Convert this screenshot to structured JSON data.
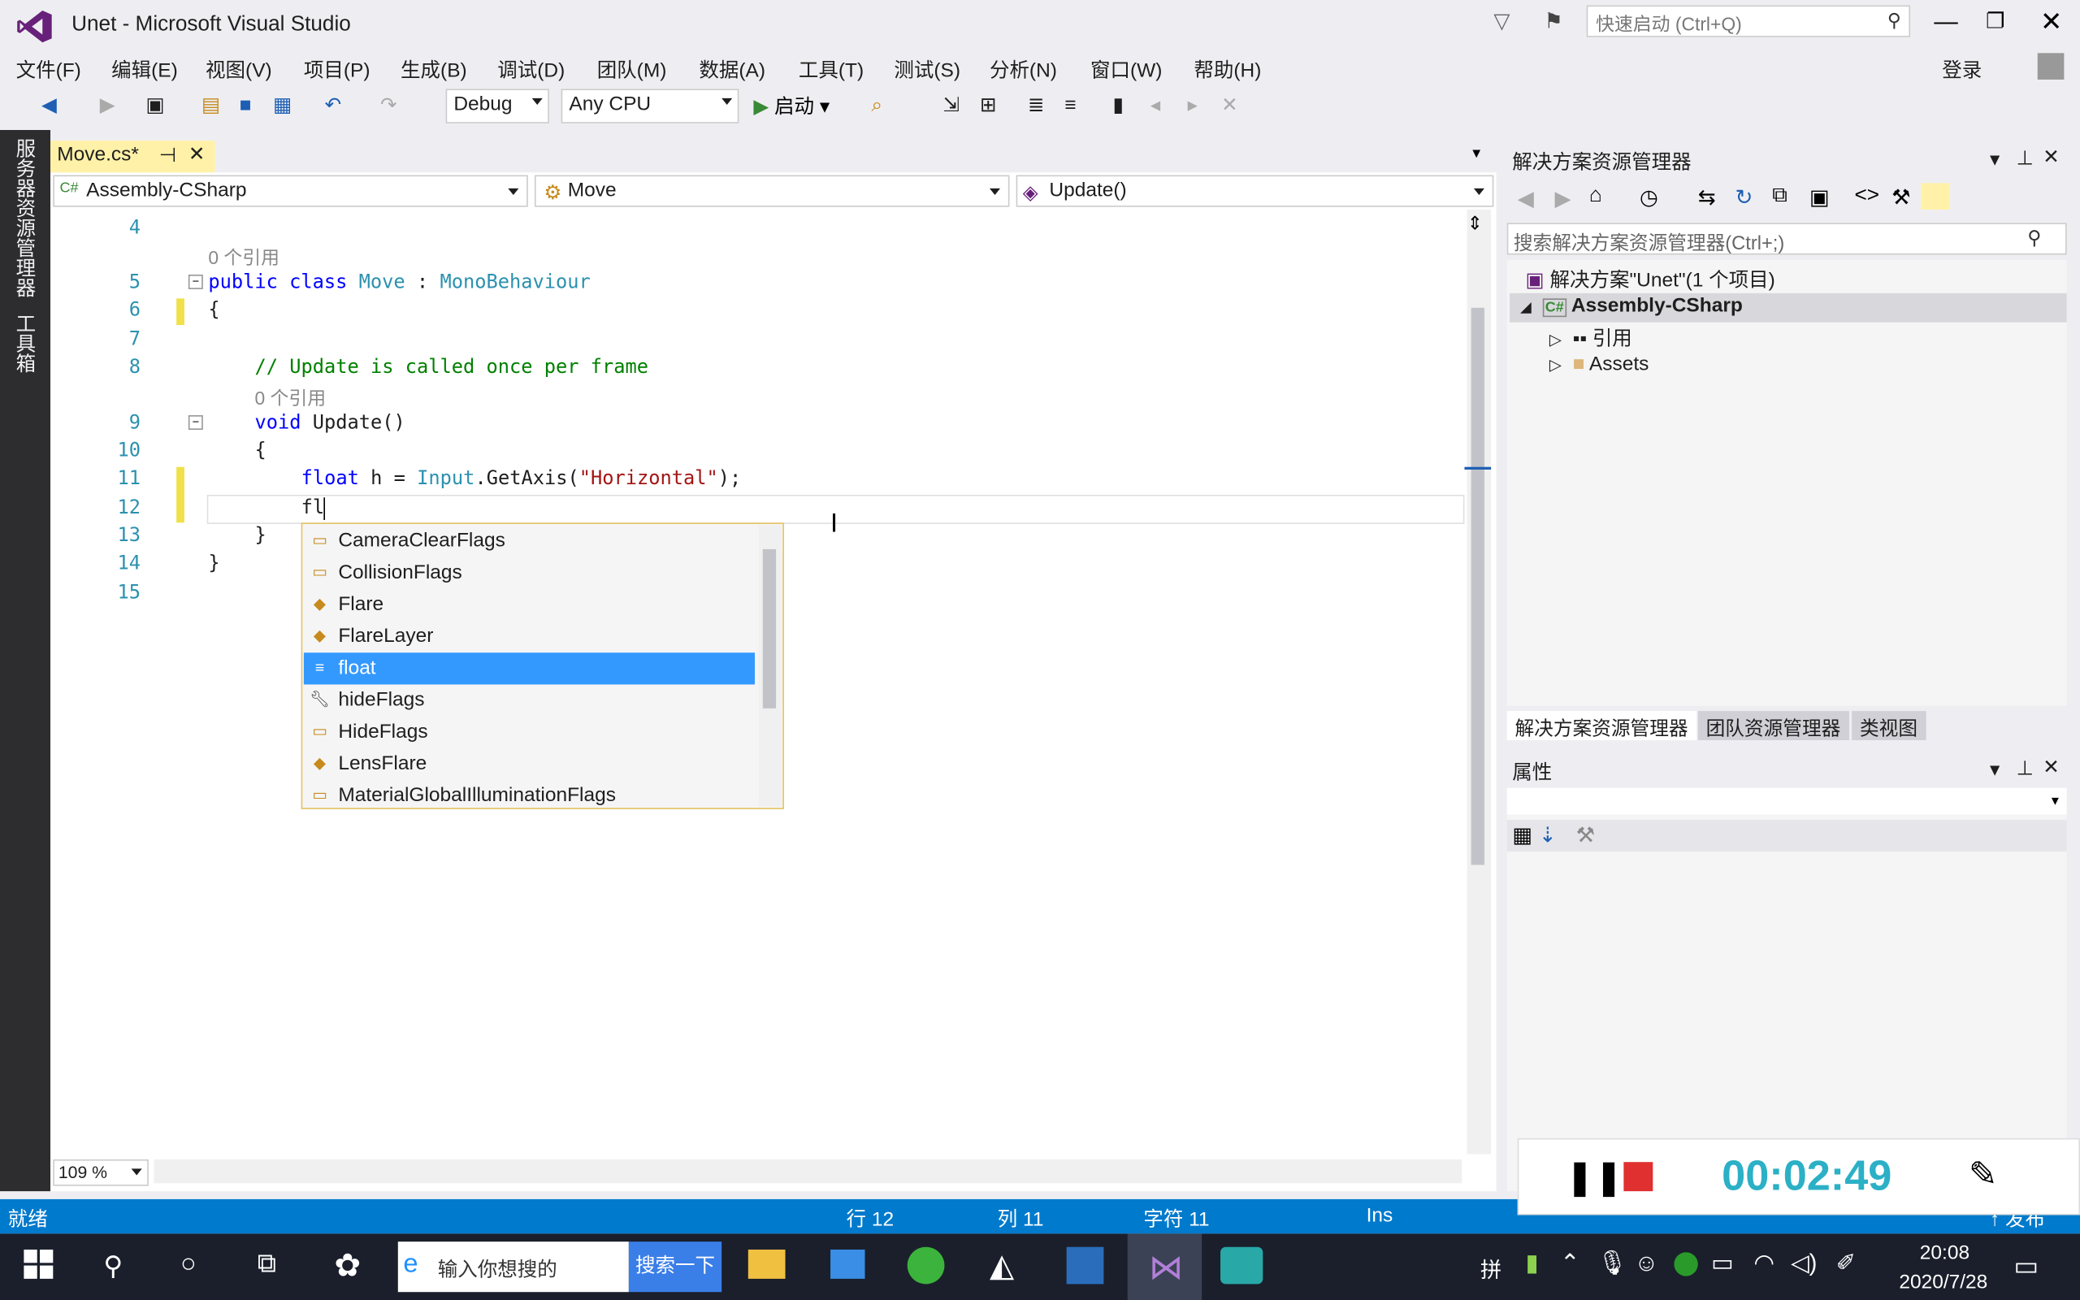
{
  "window": {
    "title": "Unet - Microsoft Visual Studio",
    "quick_launch": "快速启动 (Ctrl+Q)",
    "signin": "登录"
  },
  "menu": [
    "文件(F)",
    "编辑(E)",
    "视图(V)",
    "项目(P)",
    "生成(B)",
    "调试(D)",
    "团队(M)",
    "数据(A)",
    "工具(T)",
    "测试(S)",
    "分析(N)",
    "窗口(W)",
    "帮助(H)"
  ],
  "toolbar": {
    "config": "Debug",
    "platform": "Any CPU",
    "start_label": "启动"
  },
  "left_strip": {
    "server_explorer": "服务器资源管理器",
    "toolbox": "工具箱"
  },
  "editor": {
    "tab_label": "Move.cs*",
    "nav_project": "Assembly-CSharp",
    "nav_class": "Move",
    "nav_member": "Update()",
    "zoom": "109 %",
    "references_label": "0 个引用",
    "lines": [
      {
        "n": "4",
        "text": ""
      },
      {
        "n": "5",
        "text": "public class Move : MonoBehaviour"
      },
      {
        "n": "6",
        "text": "{"
      },
      {
        "n": "7",
        "text": ""
      },
      {
        "n": "8",
        "text": "// Update is called once per frame"
      },
      {
        "n": "9",
        "text": "void Update()"
      },
      {
        "n": "10",
        "text": "{"
      },
      {
        "n": "11",
        "text": "float h = Input.GetAxis(\"Horizontal\");"
      },
      {
        "n": "12",
        "text": "fl"
      },
      {
        "n": "13",
        "text": "}"
      },
      {
        "n": "14",
        "text": "}"
      },
      {
        "n": "15",
        "text": ""
      }
    ]
  },
  "completion": {
    "items": [
      {
        "label": "CameraClearFlags",
        "icon": "enum-icon"
      },
      {
        "label": "CollisionFlags",
        "icon": "enum-icon"
      },
      {
        "label": "Flare",
        "icon": "class-icon"
      },
      {
        "label": "FlareLayer",
        "icon": "class-icon"
      },
      {
        "label": "float",
        "icon": "keyword-icon",
        "selected": true
      },
      {
        "label": "hideFlags",
        "icon": "property-icon"
      },
      {
        "label": "HideFlags",
        "icon": "enum-icon"
      },
      {
        "label": "LensFlare",
        "icon": "class-icon"
      },
      {
        "label": "MaterialGlobalIlluminationFlags",
        "icon": "enum-icon"
      }
    ]
  },
  "solution_explorer": {
    "title": "解决方案资源管理器",
    "search_placeholder": "搜索解决方案资源管理器(Ctrl+;)",
    "solution": "解决方案\"Unet\"(1 个项目)",
    "project": "Assembly-CSharp",
    "references": "引用",
    "assets": "Assets",
    "tabs": [
      "解决方案资源管理器",
      "团队资源管理器",
      "类视图"
    ]
  },
  "properties": {
    "title": "属性"
  },
  "status": {
    "ready": "就绪",
    "line": "行 12",
    "col": "列 11",
    "char": "字符 11",
    "mode": "Ins",
    "publish": "发布"
  },
  "recorder": {
    "time": "00:02:49"
  },
  "taskbar": {
    "search_text": "输入你想搜的",
    "search_button": "搜索一下",
    "clock_time": "20:08",
    "clock_date": "2020/7/28",
    "ime": "拼"
  },
  "colors": {
    "accent": "#007acc",
    "selection": "#3399ff",
    "tab_active": "#fff1a8",
    "keyword": "#0000ff",
    "type": "#2b91af",
    "comment": "#008000",
    "string": "#a31515"
  }
}
